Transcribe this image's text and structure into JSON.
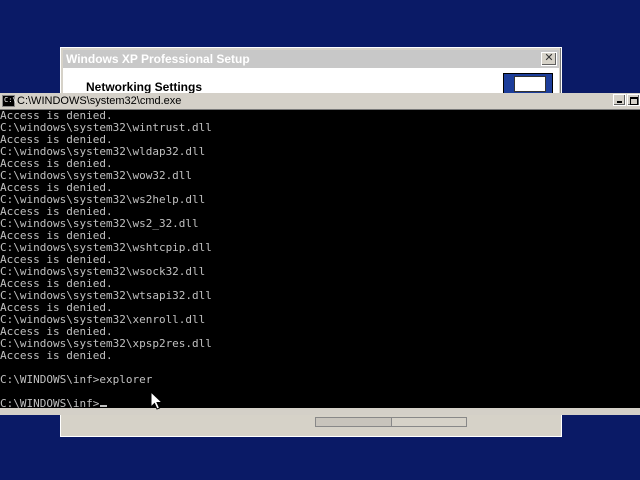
{
  "setup_window": {
    "title": "Windows XP Professional Setup",
    "close_glyph": "✕",
    "header_title": "Networking Settings",
    "progress": 0.5
  },
  "cmd_window": {
    "icon_glyph": "C:\\",
    "title": "C:\\WINDOWS\\system32\\cmd.exe",
    "lines": [
      "Access is denied.",
      "C:\\windows\\system32\\wintrust.dll",
      "Access is denied.",
      "C:\\windows\\system32\\wldap32.dll",
      "Access is denied.",
      "C:\\windows\\system32\\wow32.dll",
      "Access is denied.",
      "C:\\windows\\system32\\ws2help.dll",
      "Access is denied.",
      "C:\\windows\\system32\\ws2_32.dll",
      "Access is denied.",
      "C:\\windows\\system32\\wshtcpip.dll",
      "Access is denied.",
      "C:\\windows\\system32\\wsock32.dll",
      "Access is denied.",
      "C:\\windows\\system32\\wtsapi32.dll",
      "Access is denied.",
      "C:\\windows\\system32\\xenroll.dll",
      "Access is denied.",
      "C:\\windows\\system32\\xpsp2res.dll",
      "Access is denied.",
      "",
      "C:\\WINDOWS\\inf>explorer",
      ""
    ],
    "prompt": "C:\\WINDOWS\\inf>"
  },
  "icons": {
    "cmd": "command-prompt-icon",
    "close": "close-icon",
    "minimize": "minimize-icon",
    "maximize": "maximize-icon",
    "pointer": "mouse-pointer-icon",
    "setup_header": "network-monitor-icon"
  },
  "colors": {
    "desktop": "#0a1a66",
    "console_bg": "#000000",
    "console_text": "#c0c0c0",
    "window_face": "#d4d0c8"
  }
}
